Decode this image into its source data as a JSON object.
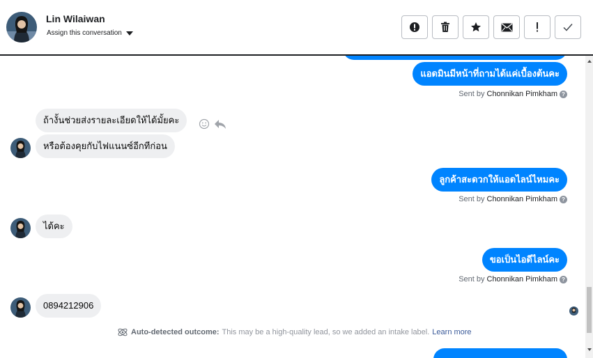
{
  "header": {
    "name": "Lin Wilaiwan",
    "assign_label": "Assign this conversation",
    "actions": [
      {
        "icon": "alert-circle-icon"
      },
      {
        "icon": "trash-icon"
      },
      {
        "icon": "star-icon"
      },
      {
        "icon": "envelope-icon"
      },
      {
        "icon": "exclamation-icon"
      },
      {
        "icon": "check-icon"
      }
    ]
  },
  "messages": [
    {
      "direction": "out",
      "text": "แอดมินมีหน้าที่ถามได้แค่เบื้องต้นคะ",
      "sent_prefix": "Sent by",
      "sender": "Chonnikan Pimkham"
    },
    {
      "direction": "in",
      "text": "ถ้างั้นช่วยส่งรายละเอียดให้ได้มั้ยคะ"
    },
    {
      "direction": "in",
      "text": "หรือต้องคุยกับไฟแนนซ์อีกทีก่อน"
    },
    {
      "direction": "out",
      "text": "ลูกค้าสะดวกให้แอดไลน์ไหมคะ",
      "sent_prefix": "Sent by",
      "sender": "Chonnikan Pimkham"
    },
    {
      "direction": "in",
      "text": "ได้คะ"
    },
    {
      "direction": "out",
      "text": "ขอเป็นไอดีไลน์คะ",
      "sent_prefix": "Sent by",
      "sender": "Chonnikan Pimkham"
    },
    {
      "direction": "in",
      "text": "0894212906"
    }
  ],
  "outcome": {
    "label": "Auto-detected outcome:",
    "text": "This may be a high-quality lead, so we added an intake label.",
    "link": "Learn more"
  },
  "colors": {
    "accent": "#0084ff",
    "incoming_bubble": "#eeeff1",
    "divider": "#1c1e21"
  }
}
